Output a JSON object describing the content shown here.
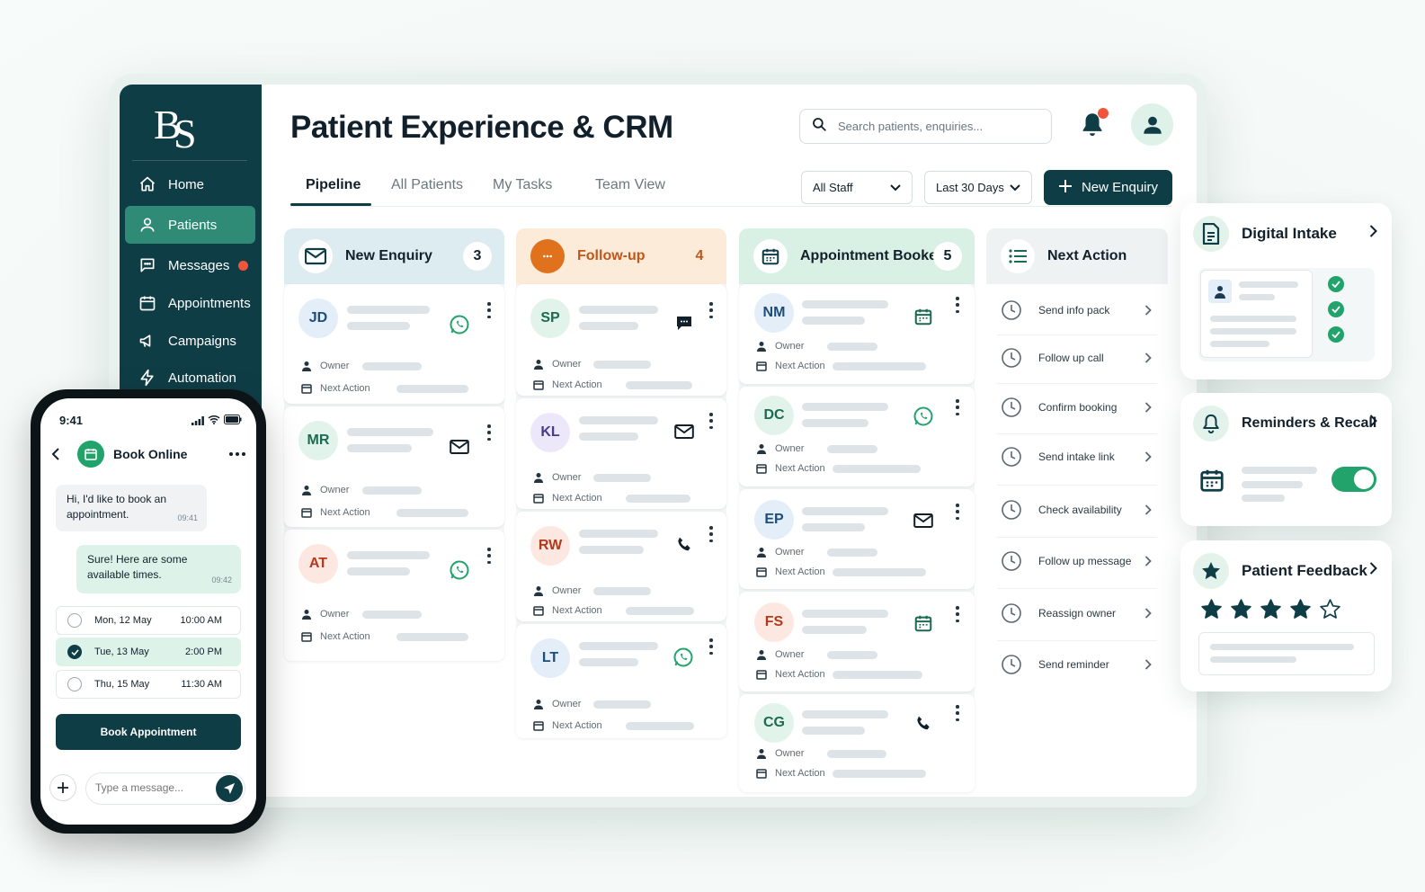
{
  "app": {
    "logo": "BS",
    "title": "Patient Experience & CRM",
    "search_placeholder": "Search patients, enquiries..."
  },
  "sidebar": {
    "items": [
      {
        "label": "Home",
        "icon": "home-icon"
      },
      {
        "label": "Patients",
        "icon": "user-icon",
        "active": true
      },
      {
        "label": "Messages",
        "icon": "chat-icon",
        "badge": true
      },
      {
        "label": "Appointments",
        "icon": "calendar-icon"
      },
      {
        "label": "Campaigns",
        "icon": "megaphone-icon"
      },
      {
        "label": "Automation",
        "icon": "lightning-icon"
      }
    ]
  },
  "tabs": [
    "Pipeline",
    "All Patients",
    "My Tasks",
    "Team View"
  ],
  "filters": {
    "staff": "All Staff",
    "range": "Last 30 Days"
  },
  "new_enquiry_button": "New Enquiry",
  "colors": {
    "brand_dark": "#0f3d46",
    "accent_green": "#22a36b",
    "alert": "#f0553b",
    "followup_orange": "#e0711d"
  },
  "columns": [
    {
      "title": "New Enquiry",
      "count": "3",
      "icon": "envelope-icon",
      "cards": [
        {
          "initials": "JD",
          "owner": "Owner",
          "next": "Next Action",
          "channel": "whatsapp-icon"
        },
        {
          "initials": "MR",
          "owner": "Owner",
          "next": "Next Action",
          "channel": "mail-icon"
        },
        {
          "initials": "AT",
          "owner": "Owner",
          "next": "Next Action",
          "channel": "whatsapp-icon"
        }
      ]
    },
    {
      "title": "Follow-up",
      "count": "4",
      "icon": "chat-bubble-icon",
      "cards": [
        {
          "initials": "SP",
          "owner": "Owner",
          "next": "Next Action",
          "channel": "sms-icon"
        },
        {
          "initials": "KL",
          "owner": "Owner",
          "next": "Next Action",
          "channel": "mail-icon"
        },
        {
          "initials": "RW",
          "owner": "Owner",
          "next": "Next Action",
          "channel": "phone-icon"
        },
        {
          "initials": "LT",
          "owner": "Owner",
          "next": "Next Action",
          "channel": "whatsapp-icon"
        }
      ]
    },
    {
      "title": "Appointment Booked",
      "count": "5",
      "icon": "calendar-icon",
      "cards": [
        {
          "initials": "NM",
          "owner": "Owner",
          "next": "Next Action",
          "channel": "calendar-icon"
        },
        {
          "initials": "DC",
          "owner": "Owner",
          "next": "Next Action",
          "channel": "whatsapp-icon"
        },
        {
          "initials": "EP",
          "owner": "Owner",
          "next": "Next Action",
          "channel": "mail-icon"
        },
        {
          "initials": "FS",
          "owner": "Owner",
          "next": "Next Action",
          "channel": "calendar-icon"
        },
        {
          "initials": "CG",
          "owner": "Owner",
          "next": "Next Action",
          "channel": "phone-icon"
        }
      ]
    }
  ],
  "next_action": {
    "title": "Next Action",
    "items": [
      "Send info pack",
      "Follow up call",
      "Confirm booking",
      "Send intake link",
      "Check availability",
      "Follow up message",
      "Reassign owner",
      "Send reminder"
    ]
  },
  "widgets": {
    "intake": "Digital Intake",
    "reminders": "Reminders & Recall",
    "feedback": "Patient Feedback",
    "rating": 4,
    "rating_max": 5
  },
  "phone": {
    "time": "9:41",
    "header": "Book Online",
    "msg_in": "Hi, I'd like to book an appointment.",
    "msg_in_time": "09:41",
    "msg_out": "Sure! Here are some available times.",
    "msg_out_time": "09:42",
    "slots": [
      {
        "day": "Mon, 12 May",
        "time": "10:00 AM",
        "selected": false
      },
      {
        "day": "Tue, 13 May",
        "time": "2:00 PM",
        "selected": true
      },
      {
        "day": "Thu, 15 May",
        "time": "11:30 AM",
        "selected": false
      }
    ],
    "book_button": "Book Appointment",
    "input_placeholder": "Type a message..."
  }
}
